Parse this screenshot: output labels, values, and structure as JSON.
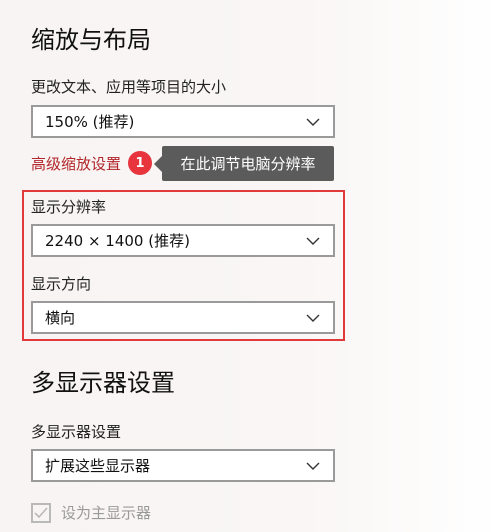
{
  "scale_layout": {
    "title": "缩放与布局",
    "text_size_label": "更改文本、应用等项目的大小",
    "text_size_value": "150% (推荐)",
    "advanced_link": "高级缩放设置",
    "step_badge": "1",
    "tooltip": "在此调节电脑分辨率",
    "resolution_label": "显示分辨率",
    "resolution_value": "2240 × 1400 (推荐)",
    "orientation_label": "显示方向",
    "orientation_value": "横向"
  },
  "multi_display": {
    "title": "多显示器设置",
    "label": "多显示器设置",
    "value": "扩展这些显示器",
    "primary_checkbox_label": "设为主显示器",
    "primary_checkbox_checked": true,
    "primary_checkbox_disabled": true
  },
  "colors": {
    "link": "#b3262b",
    "badge": "#e8343d",
    "highlight_border": "#e23a3a",
    "tooltip_bg": "#5b5b5b"
  },
  "icons": {
    "dropdown": "chevron-down-icon",
    "checkbox": "checkmark-icon"
  }
}
